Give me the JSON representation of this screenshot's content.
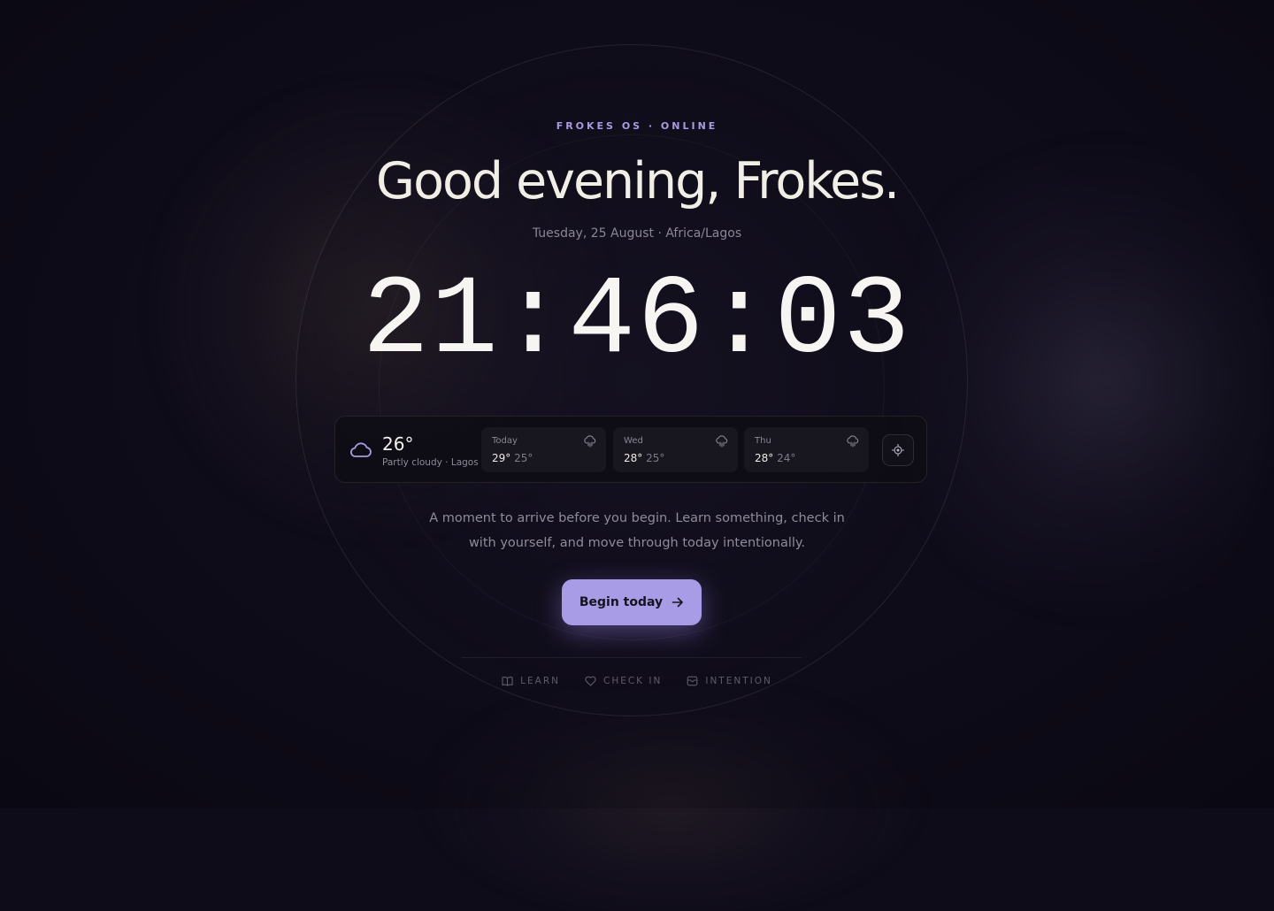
{
  "header": {
    "kicker": "FROKES OS · ONLINE",
    "greeting": "Good evening, Frokes.",
    "date_line": "Tuesday, 25 August · Africa/Lagos"
  },
  "clock": {
    "time": "21:46:03"
  },
  "weather": {
    "current": {
      "temp": "26°",
      "description": "Partly cloudy · Lagos",
      "icon": "cloud-icon"
    },
    "forecast": [
      {
        "day": "Today",
        "high": "29°",
        "low": "25°",
        "icon": "cloud-rain-icon"
      },
      {
        "day": "Wed",
        "high": "28°",
        "low": "25°",
        "icon": "cloud-rain-icon"
      },
      {
        "day": "Thu",
        "high": "28°",
        "low": "24°",
        "icon": "cloud-rain-icon"
      }
    ],
    "locate_icon": "locate-icon"
  },
  "intro": {
    "line1": "A moment to arrive before you begin. Learn something, check in",
    "line2": "with yourself, and move through today intentionally."
  },
  "cta": {
    "label": "Begin today",
    "icon": "arrow-right-icon"
  },
  "nav": [
    {
      "label": "LEARN",
      "icon": "book-icon"
    },
    {
      "label": "CHECK IN",
      "icon": "heart-icon"
    },
    {
      "label": "INTENTION",
      "icon": "inbox-icon"
    }
  ],
  "colors": {
    "background": "#0f0c1a",
    "accent": "#a89ce6",
    "kicker": "#a99be0",
    "text_primary": "#f1eee6",
    "text_muted": "#8a8696"
  }
}
